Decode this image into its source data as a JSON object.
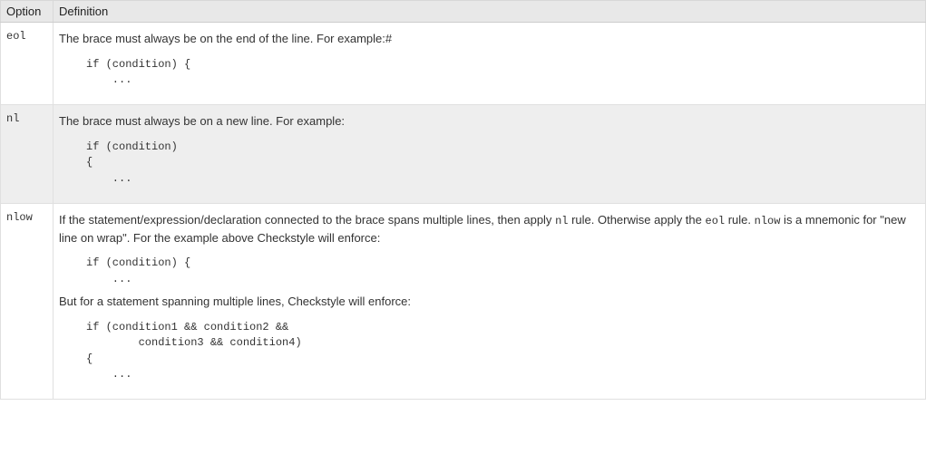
{
  "header": {
    "col_option": "Option",
    "col_definition": "Definition"
  },
  "rows": {
    "eol": {
      "option": "eol",
      "text": "The brace must always be on the end of the line. For example:",
      "anchor": "#",
      "code": "if (condition) {\n    ..."
    },
    "nl": {
      "option": "nl",
      "text": "The brace must always be on a new line. For example:",
      "code": "if (condition)\n{\n    ..."
    },
    "nlow": {
      "option": "nlow",
      "text1_a": "If the statement/expression/declaration connected to the brace spans multiple lines, then apply ",
      "inline_nl": "nl",
      "text1_b": " rule. Otherwise apply the ",
      "inline_eol": "eol",
      "text1_c": " rule. ",
      "inline_nlow": "nlow",
      "text1_d": " is a mnemonic for \"new line on wrap\". For the example above Checkstyle will enforce:",
      "code1": "if (condition) {\n    ...",
      "text2": "But for a statement spanning multiple lines, Checkstyle will enforce:",
      "code2": "if (condition1 && condition2 &&\n        condition3 && condition4)\n{\n    ..."
    }
  }
}
